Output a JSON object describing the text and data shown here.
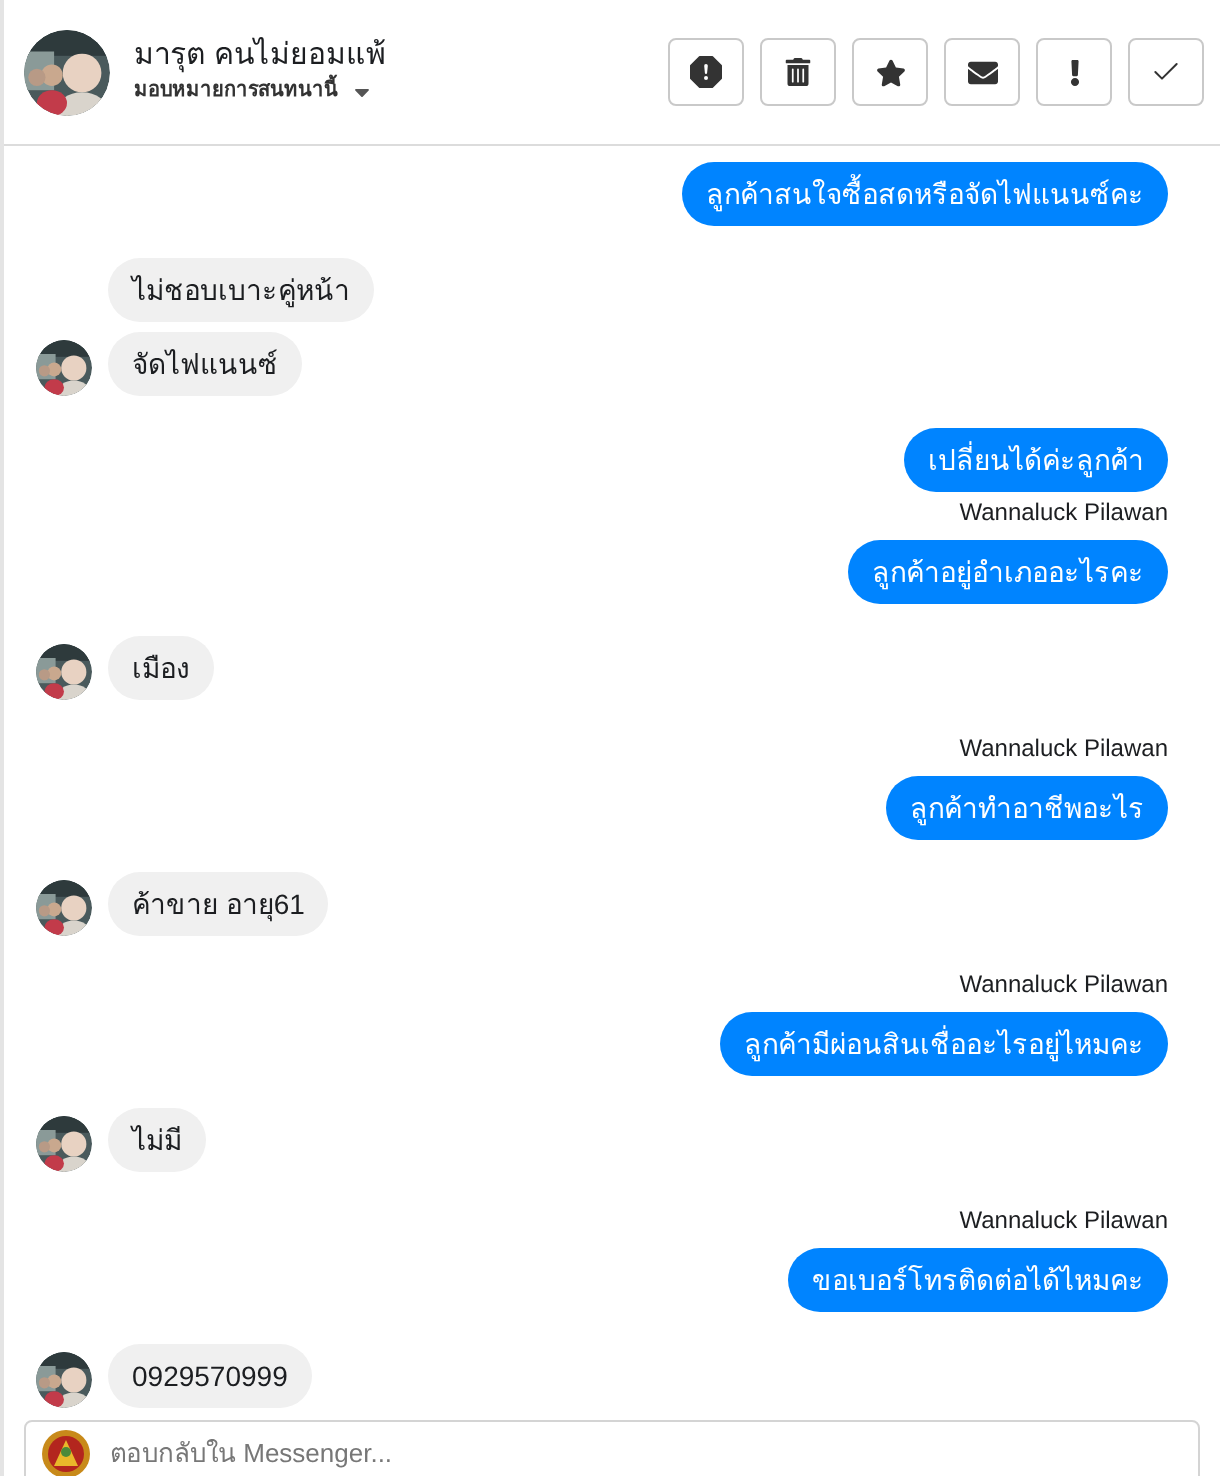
{
  "header": {
    "name": "มารุต คนไม่ยอมแพ้",
    "assign_label": "มอบหมายการสนทนานี้"
  },
  "toolbar": [
    {
      "kind": "spam"
    },
    {
      "kind": "delete"
    },
    {
      "kind": "star"
    },
    {
      "kind": "unread"
    },
    {
      "kind": "important"
    },
    {
      "kind": "done"
    }
  ],
  "messages": [
    {
      "kind": "out",
      "text": "ลูกค้าสนใจซื้อสดหรือจัดไฟแนนซ์คะ"
    },
    {
      "kind": "in",
      "text": "ไม่ชอบเบาะคู่หน้า",
      "avatar": false
    },
    {
      "kind": "in",
      "text": "จัดไฟแนนซ์",
      "avatar": true
    },
    {
      "kind": "out",
      "text": "เปลี่ยนได้ค่ะลูกค้า"
    },
    {
      "kind": "out",
      "sender": "Wannaluck Pilawan",
      "text": "ลูกค้าอยู่อำเภออะไรคะ"
    },
    {
      "kind": "in",
      "text": "เมือง",
      "avatar": true
    },
    {
      "kind": "out",
      "sender": "Wannaluck Pilawan",
      "text": "ลูกค้าทำอาชีพอะไร"
    },
    {
      "kind": "in",
      "text": "ค้าขาย อายุ61",
      "avatar": true
    },
    {
      "kind": "out",
      "sender": "Wannaluck Pilawan",
      "text": "ลูกค้ามีผ่อนสินเชื่ออะไรอยู่ไหมคะ"
    },
    {
      "kind": "in",
      "text": "ไม่มี",
      "avatar": true
    },
    {
      "kind": "out",
      "sender": "Wannaluck Pilawan",
      "text": "ขอเบอร์โทรติดต่อได้ไหมคะ"
    },
    {
      "kind": "in",
      "text": "0929570999",
      "avatar": true
    }
  ],
  "composer": {
    "placeholder": "ตอบกลับใน Messenger..."
  }
}
